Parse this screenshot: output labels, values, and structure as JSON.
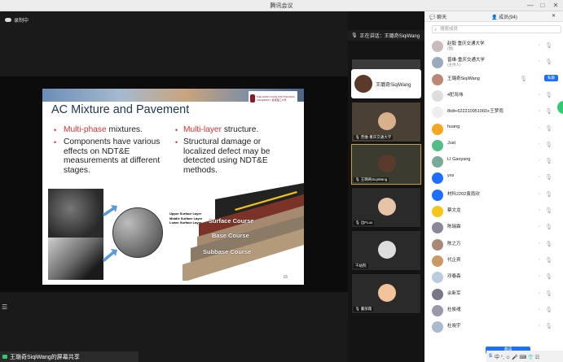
{
  "window": {
    "title": "腾讯会议"
  },
  "controls": {
    "min": "—",
    "max": "□",
    "close": "✕"
  },
  "recording": {
    "label": "录制中"
  },
  "speaking": {
    "label": "正在讲话：王璐奇SiqiWang"
  },
  "slide": {
    "title": "AC Mixture and Pavement",
    "left_bullet_1_red": "Multi-phase",
    "left_bullet_1_rest": " mixtures.",
    "left_bullet_2": "Components have various effects on NDT&E measurements at different stages.",
    "right_bullet_1_red": "Multi-layer",
    "right_bullet_1_rest": " structure.",
    "right_bullet_2": "Structural damage or localized defect may be detected using NDT&E methods.",
    "layer_surface": "Surface Course",
    "layer_base": "Base Course",
    "layer_subbase": "Subbase Course",
    "layer_upper": "Upper Surface Layer",
    "layer_middle": "Middle Surface Layer",
    "layer_lower": "Lower Surface Layer",
    "page_number": "15",
    "logo_text": "THE HONG KONG POLYTECHNIC UNIVERSITY 香港理工大學"
  },
  "sharebar": {
    "label": "王璐奇SiqiWang的屏幕共享"
  },
  "videos": {
    "speaker_card": "王璐奇SiqiWang",
    "tile1": "...",
    "tile2": "曾维-重庆交通大学",
    "tile3": "王璐奇SiqiWang",
    "tile4": "边FLux",
    "tile5": "千站院",
    "tile6": "董丽霞"
  },
  "panel": {
    "tab_chat": "聊天",
    "tab_members": "成员(94)",
    "search_placeholder": "搜索成员",
    "members": [
      {
        "name": "赵毅 重庆交通大学",
        "sub": "(我)"
      },
      {
        "name": "曾维-重庆交通大学",
        "sub": "(主持人)"
      },
      {
        "name": "王璐奇SiqiWang",
        "sub": "",
        "button": "私聊"
      },
      {
        "name": "4犯骂伟",
        "sub": ""
      },
      {
        "name": "8tdt+622210951060+王梦雨",
        "sub": ""
      },
      {
        "name": "huang",
        "sub": ""
      },
      {
        "name": "Just",
        "sub": ""
      },
      {
        "name": "LI Gaoyang",
        "sub": ""
      },
      {
        "name": "yxs",
        "sub": ""
      },
      {
        "name": "材科2202袁雨欣",
        "sub": ""
      },
      {
        "name": "蔡文龙",
        "sub": ""
      },
      {
        "name": "陈瑞霖",
        "sub": ""
      },
      {
        "name": "陈之万",
        "sub": ""
      },
      {
        "name": "代企宾",
        "sub": ""
      },
      {
        "name": "邓春森",
        "sub": ""
      },
      {
        "name": "佘新军",
        "sub": ""
      },
      {
        "name": "杜俊魂",
        "sub": ""
      },
      {
        "name": "杜晓宇",
        "sub": ""
      }
    ],
    "bottom_button": "邀请"
  },
  "ime": {
    "s": "S",
    "text": "中 °, ☺ 🎤 ⌨ 👕 ☷"
  },
  "colors": {
    "accent": "#1e6fff",
    "slide_title": "#1d3557",
    "red": "#e03131"
  }
}
